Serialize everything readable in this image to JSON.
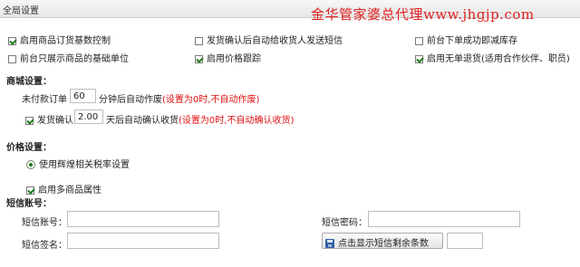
{
  "header": {
    "title": "全局设置",
    "watermark": "金华管家婆总代理www.jhgjp.com"
  },
  "global_options": [
    {
      "label": "启用商品订货基数控制",
      "checked": true
    },
    {
      "label": "发货确认后自动给收货人发送短信",
      "checked": false
    },
    {
      "label": "前台下单成功即减库存",
      "checked": false
    },
    {
      "label": "前台只展示商品的基础单位",
      "checked": false
    },
    {
      "label": "启用价格跟踪",
      "checked": true
    },
    {
      "label": "启用无单退货(适用合作伙伴、职员)",
      "checked": true
    }
  ],
  "mall": {
    "title": "商城设置：",
    "unpaid_prefix": "未付款订单",
    "unpaid_value": "60",
    "unpaid_suffix": "分钟后自动作废",
    "unpaid_hint": "(设置为0时,不自动作废)",
    "ship_label": "发货确认",
    "ship_checked": true,
    "ship_value": "2.00",
    "ship_suffix": "天后自动确认收货",
    "ship_hint": "(设置为0时,不自动确认收货)"
  },
  "price": {
    "title": "价格设置：",
    "tax_option": "使用辉煌相关税率设置",
    "tax_selected": true,
    "multi_attr": "启用多商品属性",
    "multi_attr_checked": true
  },
  "sms": {
    "title": "短信账号：",
    "account_label": "短信账号：",
    "account_value": "",
    "password_label": "短信密码：",
    "password_value": "",
    "signature_label": "短信签名：",
    "signature_value": "",
    "remaining_button": "点击显示短信剩余条数",
    "remaining_value": ""
  }
}
